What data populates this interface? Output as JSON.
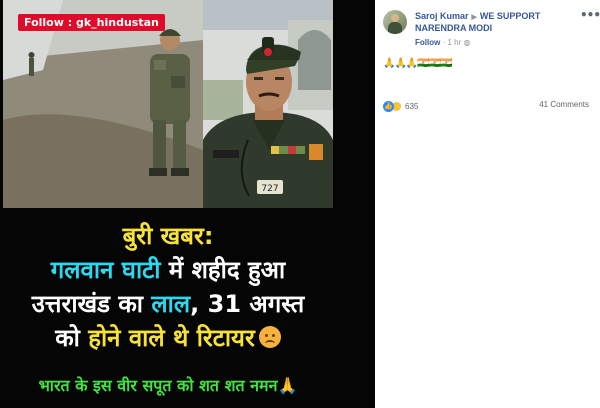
{
  "media": {
    "follow_tag": "Follow : gk_hindustan",
    "badge_number": "727",
    "headline": {
      "line1": "बुरी खबर:",
      "line2_a": "गलवान घाटी",
      "line2_b": " में शहीद हुआ",
      "line3_a": "उत्तराखंड का ",
      "line3_b": "लाल",
      "line3_c": ", 31 अगस्त",
      "line4_a": "को ",
      "line4_b": "होने वाले थे रिटायर"
    },
    "footer": "भारत के इस वीर सपूत को शत शत नमन",
    "footer_emoji": "🙏"
  },
  "post": {
    "author": "Saroj Kumar",
    "group": "WE SUPPORT NARENDRA MODI",
    "follow_label": "Follow",
    "time": "1 hr",
    "more_label": "•••",
    "text_pray": "🙏🙏🙏",
    "text_flags": "🇮🇳🇮🇳🇮🇳",
    "reaction_count": "635",
    "comments": "41 Comments"
  },
  "colors": {
    "follow_tag_bg": "#e00a2a",
    "headline_yellow": "#f7e23a",
    "headline_cyan": "#2bd9f0",
    "headline_pink": "#ff7ec7",
    "footer_green": "#43e143",
    "link_blue": "#365899",
    "like_blue": "#2d88ff"
  },
  "icons": [
    "avatar",
    "dropdown-arrow-icon",
    "more-options-icon",
    "like-reaction-icon",
    "sad-reaction-icon",
    "sad-face-emoji",
    "praying-hands-emoji",
    "india-flag-emoji"
  ]
}
